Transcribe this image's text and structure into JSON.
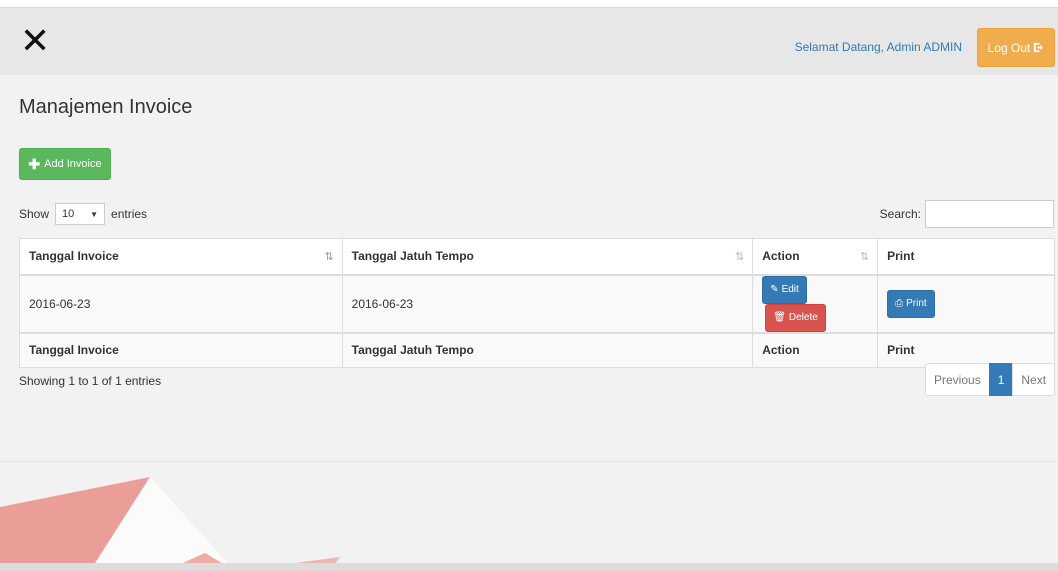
{
  "header": {
    "close_icon": "close-icon",
    "welcome": "Selamat Datang, Admin ADMIN",
    "logout_label": "Log Out",
    "colors": {
      "navbar": "#e7e7e7",
      "logout": "#f0ad4e",
      "link": "#337ab7"
    }
  },
  "page": {
    "title": "Manajemen Invoice",
    "add_button_label": "Add Invoice"
  },
  "table_controls": {
    "show_label": "Show",
    "entries_selected": "10",
    "entries_label": "entries",
    "search_label": "Search:",
    "search_value": ""
  },
  "table": {
    "columns": [
      "Tanggal Invoice",
      "Tanggal Jatuh Tempo",
      "Action",
      "Print"
    ],
    "rows": [
      {
        "tanggal_invoice": "2016-06-23",
        "tanggal_jatuh_tempo": "2016-06-23",
        "edit_label": "Edit",
        "delete_label": "Delete",
        "print_label": "Print"
      }
    ],
    "footer_columns": [
      "Tanggal Invoice",
      "Tanggal Jatuh Tempo",
      "Action",
      "Print"
    ]
  },
  "pagination": {
    "info": "Showing 1 to 1 of 1 entries",
    "previous": "Previous",
    "current_page": "1",
    "next": "Next"
  }
}
